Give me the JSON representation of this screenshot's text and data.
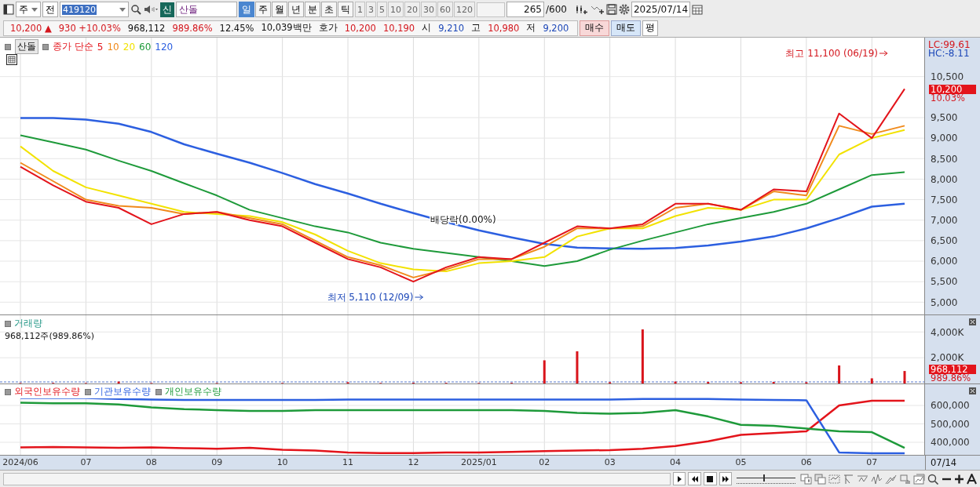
{
  "toolbar": {
    "market": "주",
    "prev_button": "전",
    "code": "419120",
    "new_badge": "신",
    "stock_name": "산돌",
    "periods": [
      {
        "label": "일",
        "selected": true
      },
      {
        "label": "주",
        "selected": false
      },
      {
        "label": "월",
        "selected": false
      },
      {
        "label": "년",
        "selected": false
      },
      {
        "label": "분",
        "selected": false
      },
      {
        "label": "초",
        "selected": false
      },
      {
        "label": "틱",
        "selected": false
      }
    ],
    "intervals": [
      "1",
      "3",
      "5",
      "10",
      "20",
      "30",
      "60",
      "120"
    ],
    "count": "265",
    "count_max": "/600",
    "date": "2025/07/14"
  },
  "quote_bar": {
    "items": [
      {
        "text": "10,200 ▲",
        "color": "#d4171e"
      },
      {
        "text": "930 +10.03%",
        "color": "#d4171e"
      },
      {
        "text": "968,112"
      },
      {
        "text": "989.86%",
        "color": "#d4171e"
      },
      {
        "text": "12.45%"
      },
      {
        "text": "10,039백만"
      },
      {
        "text": "호가"
      },
      {
        "text": "10,200",
        "color": "#d4171e"
      },
      {
        "text": "10,190",
        "color": "#d4171e"
      },
      {
        "text": "시"
      },
      {
        "text": "9,210",
        "color": "#1d48b8"
      },
      {
        "text": "고"
      },
      {
        "text": "10,980",
        "color": "#d4171e"
      },
      {
        "text": "저"
      },
      {
        "text": "9,200",
        "color": "#1d48b8"
      }
    ],
    "buy_button": "매수",
    "sell_button": "매도",
    "avg_button": "평"
  },
  "price_pane": {
    "stock_tag": "산돌",
    "legend_prefix": "종가 단순",
    "lc": "LC:99.61",
    "hc": "HC:-8.11",
    "price_tag": "10,200",
    "change_tag": "10.03%",
    "chart_data": {
      "type": "line",
      "grid": true,
      "ylim": [
        4700,
        11450
      ],
      "categories": [
        null,
        null,
        null,
        null,
        null,
        null,
        null,
        null,
        null,
        null,
        null,
        null,
        null,
        null,
        null,
        null,
        null,
        null,
        null,
        null,
        null,
        null,
        null,
        null,
        null,
        null,
        null,
        null
      ],
      "yticks": [
        {
          "value": 5000,
          "label": "5,000"
        },
        {
          "value": 5500,
          "label": "5,500"
        },
        {
          "value": 6000,
          "label": "6,000"
        },
        {
          "value": 6500,
          "label": "6,500"
        },
        {
          "value": 7000,
          "label": "7,000"
        },
        {
          "value": 7500,
          "label": "7,500"
        },
        {
          "value": 8000,
          "label": "8,000"
        },
        {
          "value": 8500,
          "label": "8,500"
        },
        {
          "value": 9000,
          "label": "9,000"
        },
        {
          "value": 9500,
          "label": "9,500"
        },
        {
          "value": 10500,
          "label": "10,500"
        }
      ],
      "series": [
        {
          "name": "120",
          "color": "#2c5fe0",
          "values": [
            9490,
            9490,
            9450,
            9350,
            9150,
            8850,
            8620,
            8400,
            8150,
            7880,
            7650,
            7400,
            7170,
            6950,
            6750,
            6580,
            6420,
            6330,
            6310,
            6300,
            6320,
            6380,
            6480,
            6600,
            6800,
            7050,
            7330,
            7400
          ]
        },
        {
          "name": "60",
          "color": "#1e9a3a",
          "values": [
            9070,
            8900,
            8720,
            8450,
            8200,
            7900,
            7600,
            7250,
            7050,
            6850,
            6700,
            6450,
            6300,
            6200,
            6100,
            6000,
            5880,
            6000,
            6280,
            6500,
            6700,
            6900,
            7050,
            7200,
            7400,
            7750,
            8100,
            8170
          ]
        },
        {
          "name": "20",
          "color": "#f2e200",
          "values": [
            8800,
            8200,
            7800,
            7600,
            7400,
            7200,
            7150,
            7100,
            6950,
            6650,
            6250,
            5950,
            5800,
            5750,
            5950,
            6000,
            6100,
            6600,
            6800,
            6800,
            7100,
            7300,
            7250,
            7500,
            7500,
            8600,
            9000,
            9200
          ]
        },
        {
          "name": "10",
          "color": "#f08a1c",
          "values": [
            8400,
            7950,
            7500,
            7350,
            7300,
            7150,
            7200,
            7050,
            6900,
            6500,
            6100,
            5900,
            5600,
            5800,
            6050,
            6050,
            6350,
            6800,
            6800,
            6850,
            7300,
            7400,
            7250,
            7700,
            7600,
            9300,
            9100,
            9300
          ]
        },
        {
          "name": "5",
          "color": "#e3141b",
          "values": [
            8300,
            7850,
            7450,
            7300,
            6900,
            7150,
            7200,
            7000,
            6850,
            6450,
            6050,
            5850,
            5500,
            5850,
            6100,
            6050,
            6450,
            6850,
            6800,
            6900,
            7400,
            7400,
            7250,
            7750,
            7700,
            9600,
            9000,
            10200
          ]
        }
      ],
      "annotations": [
        "최고 11,100 (06/19)",
        "최저 5,110 (12/09)",
        "배당락(0.00%)"
      ]
    }
  },
  "volume_pane": {
    "title": "거래량",
    "reading": "968,112주(989.86%)",
    "volume_tag": "968,112",
    "ratio_tag": "989.86%",
    "chart_data": {
      "type": "bar",
      "grid": true,
      "ylim": [
        0,
        5300
      ],
      "categories": [
        null,
        null,
        null,
        null,
        null,
        null,
        null,
        null,
        null,
        null,
        null,
        null,
        null,
        null,
        null,
        null,
        null,
        null,
        null,
        null,
        null,
        null,
        null,
        null,
        null,
        null,
        null,
        null
      ],
      "values": [
        40,
        50,
        40,
        150,
        40,
        null,
        40,
        null,
        40,
        null,
        100,
        40,
        60,
        50,
        40,
        50,
        1800,
        2500,
        100,
        4200,
        150,
        120,
        100,
        120,
        100,
        1400,
        400,
        970
      ],
      "yticks": [
        {
          "value": 2000,
          "label": "2,000K"
        },
        {
          "value": 4000,
          "label": "4,000K"
        }
      ]
    }
  },
  "holdings_pane": {
    "chart_data": {
      "type": "line",
      "grid": true,
      "ylim": [
        332000,
        715000
      ],
      "categories": [
        "2024/06",
        null,
        "07",
        null,
        "08",
        null,
        "09",
        null,
        "10",
        null,
        "11",
        null,
        "12",
        null,
        "2025/01",
        null,
        "02",
        null,
        "03",
        null,
        "04",
        null,
        "05",
        null,
        "06",
        null,
        "07",
        null
      ],
      "yticks": [
        {
          "value": 400000,
          "label": "400,000"
        },
        {
          "value": 500000,
          "label": "500,000"
        },
        {
          "value": 600000,
          "label": "600,000"
        }
      ],
      "series": [
        {
          "name": "외국인보유수량",
          "color": "#e3141b",
          "values": [
            372000,
            375000,
            372000,
            370000,
            372000,
            368000,
            365000,
            370000,
            360000,
            355000,
            345000,
            342000,
            342000,
            345000,
            345000,
            348000,
            352000,
            355000,
            358000,
            365000,
            380000,
            405000,
            440000,
            450000,
            460000,
            600000,
            625000,
            625000
          ]
        },
        {
          "name": "기관보유수량",
          "color": "#2c5fe0",
          "values": [
            640000,
            640000,
            640000,
            635000,
            632000,
            630000,
            630000,
            630000,
            630000,
            630000,
            632000,
            632000,
            632000,
            632000,
            632000,
            632000,
            632000,
            632000,
            632000,
            635000,
            635000,
            635000,
            632000,
            630000,
            628000,
            345000,
            340000,
            340000
          ]
        },
        {
          "name": "개인보유수량",
          "color": "#1e9a3a",
          "values": [
            615000,
            612000,
            612000,
            605000,
            590000,
            580000,
            575000,
            570000,
            570000,
            575000,
            575000,
            575000,
            575000,
            575000,
            575000,
            575000,
            570000,
            560000,
            555000,
            560000,
            575000,
            540000,
            495000,
            490000,
            475000,
            460000,
            455000,
            370000
          ]
        }
      ]
    }
  },
  "x_axis_end_label": "07/14",
  "bottom_toolbar": {
    "zoom_slider": {
      "level": 0.45
    }
  }
}
